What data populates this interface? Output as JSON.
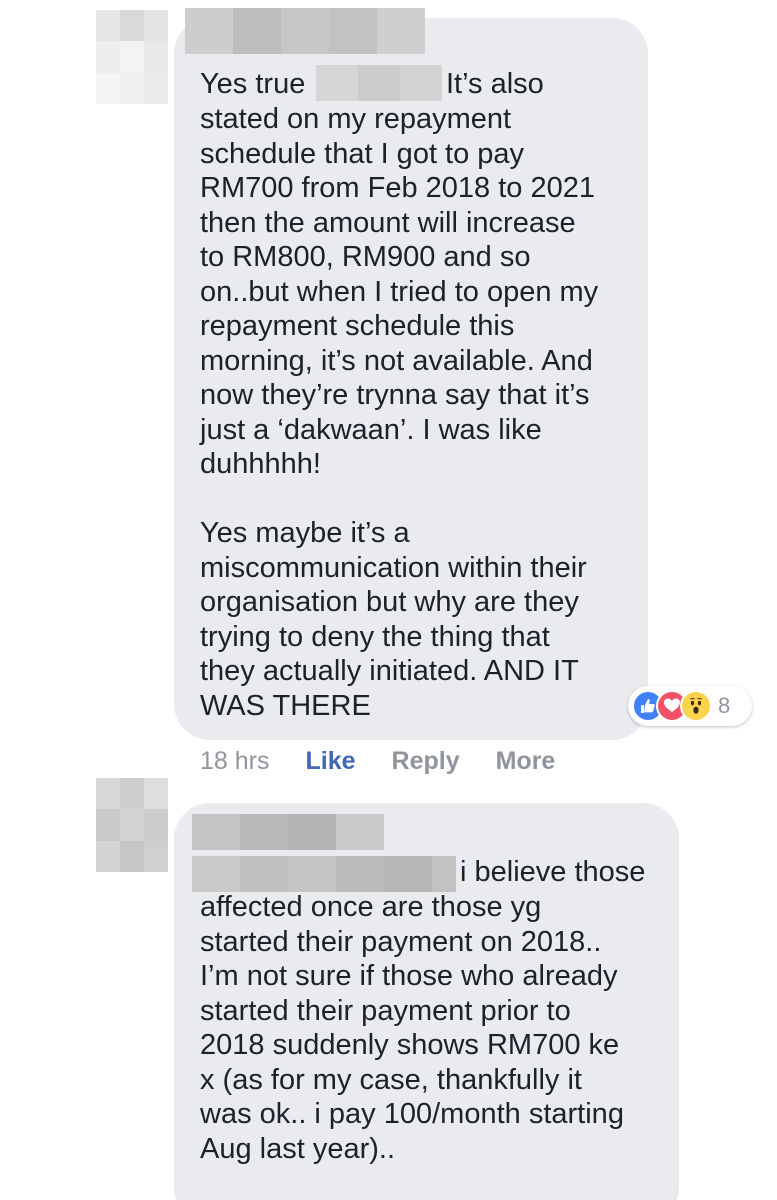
{
  "comments": [
    {
      "text_line1": "Yes true",
      "text_line1_after": "It’s also",
      "text_rest": "stated on my repayment\nschedule that I got to pay\nRM700 from Feb 2018 to 2021\nthen the amount will increase\nto RM800, RM900 and so\non..but when I tried to open my\nrepayment schedule this\nmorning, it’s not available. And\nnow they’re trynna say that it’s\njust a ‘dakwaan’. I was like\nduhhhhh!\n\nYes maybe it’s a\nmiscommunication within their\norganisation but why are they\ntrying to deny the thing that\nthey actually initiated. AND IT\nWAS THERE",
      "reactions": {
        "icons": [
          "like-icon",
          "love-icon",
          "wow-icon"
        ],
        "count": "8"
      },
      "actions": {
        "time": "18 hrs",
        "like": "Like",
        "reply": "Reply",
        "more": "More"
      }
    },
    {
      "text_line1_after": "i believe those",
      "text_rest": "affected once are those yg\nstarted their payment on 2018..\nI’m not sure if those who already\nstarted their payment prior to\n2018 suddenly shows RM700 ke\nx (as for my case, thankfully it\nwas ok.. i pay 100/month starting\nAug last year).."
    }
  ],
  "colors": {
    "bubble": "#e9ebee",
    "text": "#1d2129",
    "meta": "#90949c",
    "like_blue": "#4267b2",
    "reaction_like": "#4080ff",
    "reaction_love": "#f25268",
    "reaction_wow": "#fcd34d"
  }
}
